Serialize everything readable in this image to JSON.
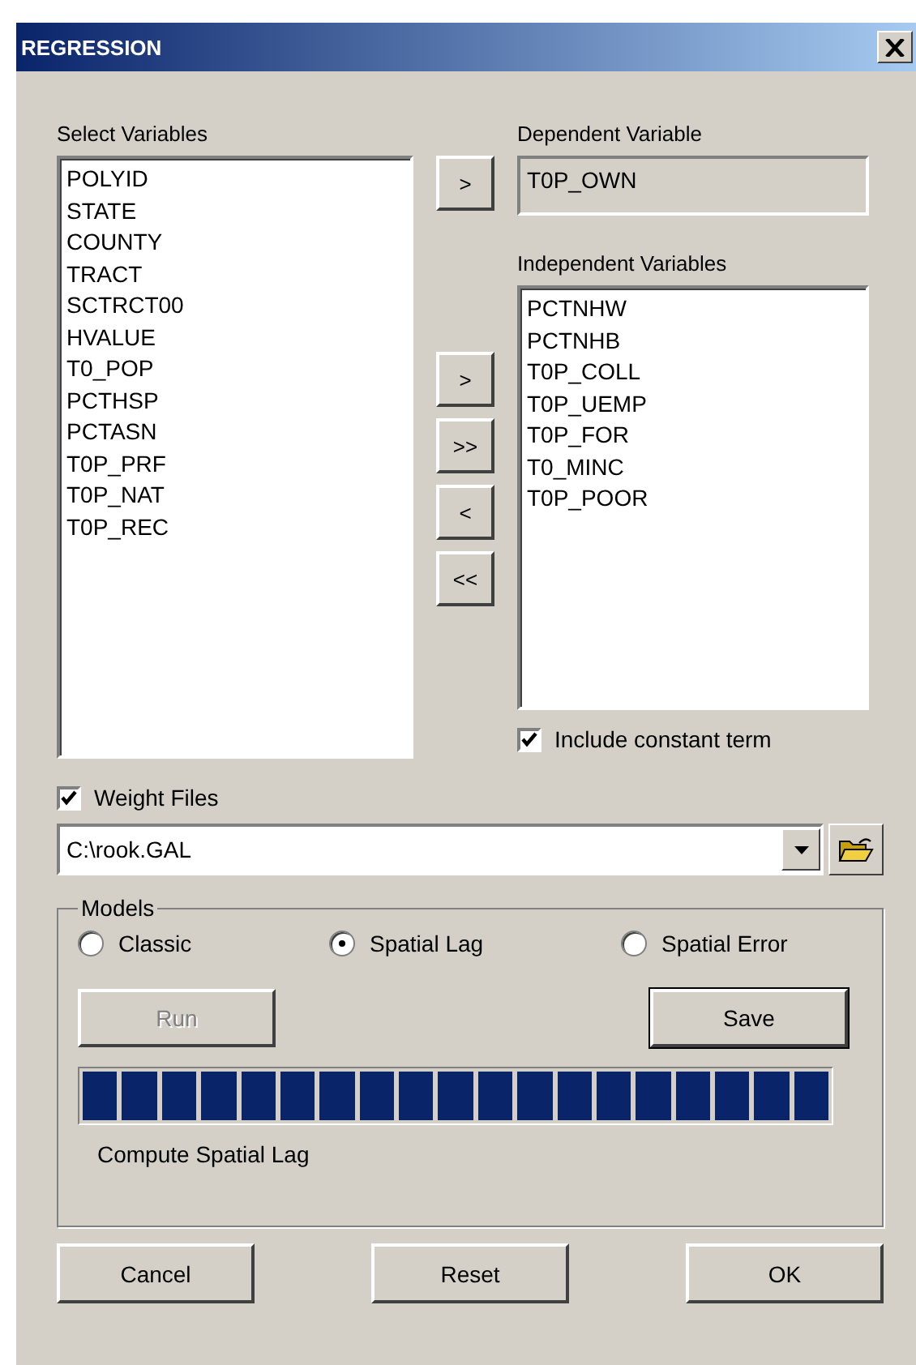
{
  "window": {
    "title": "REGRESSION"
  },
  "select_variables": {
    "label": "Select Variables",
    "items": [
      "POLYID",
      "STATE",
      "COUNTY",
      "TRACT",
      "SCTRCT00",
      "HVALUE",
      "T0_POP",
      "PCTHSP",
      "PCTASN",
      "T0P_PRF",
      "T0P_NAT",
      "T0P_REC"
    ]
  },
  "dependent_variable": {
    "label": "Dependent Variable",
    "value": "T0P_OWN",
    "move_button": ">"
  },
  "move_buttons": [
    ">",
    ">>",
    "<",
    "<<"
  ],
  "independent_variables": {
    "label": "Independent Variables",
    "items": [
      "PCTNHW",
      "PCTNHB",
      "T0P_COLL",
      "T0P_UEMP",
      "T0P_FOR",
      "T0_MINC",
      "T0P_POOR"
    ]
  },
  "include_constant": {
    "label": "Include constant term",
    "checked": true
  },
  "weight_files": {
    "label": "Weight Files",
    "checked": true,
    "value": "C:\\rook.GAL"
  },
  "models": {
    "label": "Models",
    "options": [
      {
        "label": "Classic",
        "selected": false
      },
      {
        "label": "Spatial Lag",
        "selected": true
      },
      {
        "label": "Spatial Error",
        "selected": false
      }
    ],
    "run": {
      "label": "Run",
      "disabled": true,
      "focused": false
    },
    "save": {
      "label": "Save",
      "disabled": false,
      "focused": true
    },
    "progress": {
      "level": 1
    },
    "status": "Compute Spatial Lag"
  },
  "buttons": [
    "Cancel",
    "Reset",
    "OK"
  ]
}
